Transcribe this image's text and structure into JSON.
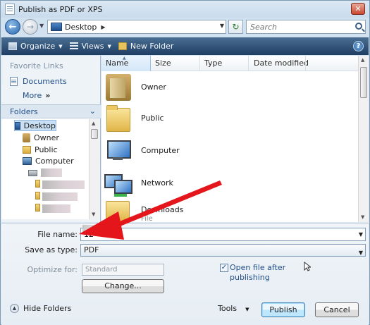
{
  "window": {
    "title": "Publish as PDF or XPS"
  },
  "address": {
    "location": "Desktop",
    "search_placeholder": "Search"
  },
  "toolbar": {
    "organize": "Organize",
    "views": "Views",
    "new_folder": "New Folder"
  },
  "nav": {
    "favorite_links_header": "Favorite Links",
    "documents": "Documents",
    "more": "More",
    "more_chevron": "»",
    "folders_header": "Folders",
    "tree": [
      {
        "label": "Desktop",
        "icon": "desktop-icon"
      },
      {
        "label": "Owner",
        "icon": "user-folder-icon"
      },
      {
        "label": "Public",
        "icon": "folder-icon"
      },
      {
        "label": "Computer",
        "icon": "computer-icon"
      }
    ]
  },
  "columns": [
    "Name",
    "Size",
    "Type",
    "Date modified"
  ],
  "items": [
    {
      "name": "Owner",
      "icon": "user-folder-icon"
    },
    {
      "name": "Public",
      "icon": "folder-icon"
    },
    {
      "name": "Computer",
      "icon": "computer-icon"
    },
    {
      "name": "Network",
      "icon": "network-icon"
    },
    {
      "name": "Downloads",
      "sub": "File Folder",
      "icon": "folder-icon"
    }
  ],
  "fields": {
    "file_name_label": "File name:",
    "file_name_value": "12",
    "save_type_label": "Save as type:",
    "save_type_value": "PDF",
    "optimize_label": "Optimize for:",
    "optimize_value": "Standard",
    "change_button": "Change...",
    "open_after_label": "Open file after publishing"
  },
  "footer": {
    "hide_folders": "Hide Folders",
    "tools": "Tools",
    "publish": "Publish",
    "cancel": "Cancel"
  },
  "colors": {
    "arrow": "#e4161b",
    "toolbar": "#2b4d74",
    "link": "#1f4e85"
  }
}
